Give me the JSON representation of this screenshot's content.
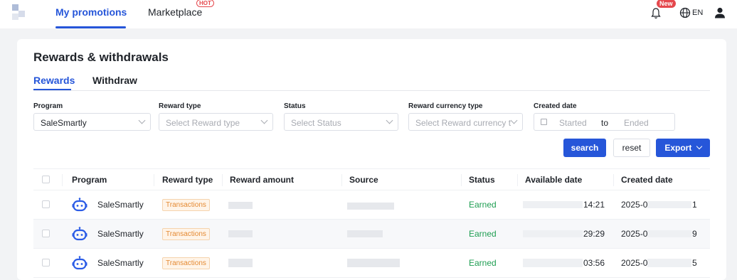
{
  "nav": {
    "my_promotions": "My promotions",
    "marketplace": "Marketplace",
    "hot_badge": "HOT",
    "new_badge": "New",
    "language": "EN",
    "icons": [
      "bell-icon",
      "globe-icon",
      "user-icon"
    ]
  },
  "page": {
    "title": "Rewards & withdrawals",
    "tabs": [
      "Rewards",
      "Withdraw"
    ],
    "active_tab": "Rewards"
  },
  "filters": {
    "program": {
      "label": "Program",
      "value": "SaleSmartly"
    },
    "reward_type": {
      "label": "Reward type",
      "placeholder": "Select Reward type"
    },
    "status": {
      "label": "Status",
      "placeholder": "Select Status"
    },
    "currency": {
      "label": "Reward currency type",
      "placeholder": "Select Reward currency t"
    },
    "created_date": {
      "label": "Created date",
      "start_placeholder": "Started",
      "separator": "to",
      "end_placeholder": "Ended"
    }
  },
  "buttons": {
    "search": "search",
    "reset": "reset",
    "export": "Export"
  },
  "table": {
    "columns": [
      "Program",
      "Reward type",
      "Reward amount",
      "Source",
      "Status",
      "Available date",
      "Created date"
    ],
    "rows": [
      {
        "program": "SaleSmartly",
        "reward_type": "Transactions",
        "status": "Earned",
        "available_date_visible": "14:21",
        "created_date_visible": "2025-0",
        "created_tail": "1"
      },
      {
        "program": "SaleSmartly",
        "reward_type": "Transactions",
        "status": "Earned",
        "available_date_visible": "29:29",
        "created_date_visible": "2025-0",
        "created_tail": "9"
      },
      {
        "program": "SaleSmartly",
        "reward_type": "Transactions",
        "status": "Earned",
        "available_date_visible": "03:56",
        "created_date_visible": "2025-0",
        "created_tail": "5"
      }
    ]
  },
  "colors": {
    "accent": "#2656d9",
    "earned": "#1f9e52",
    "tag_text": "#e48a33",
    "badge": "#e5484d"
  }
}
